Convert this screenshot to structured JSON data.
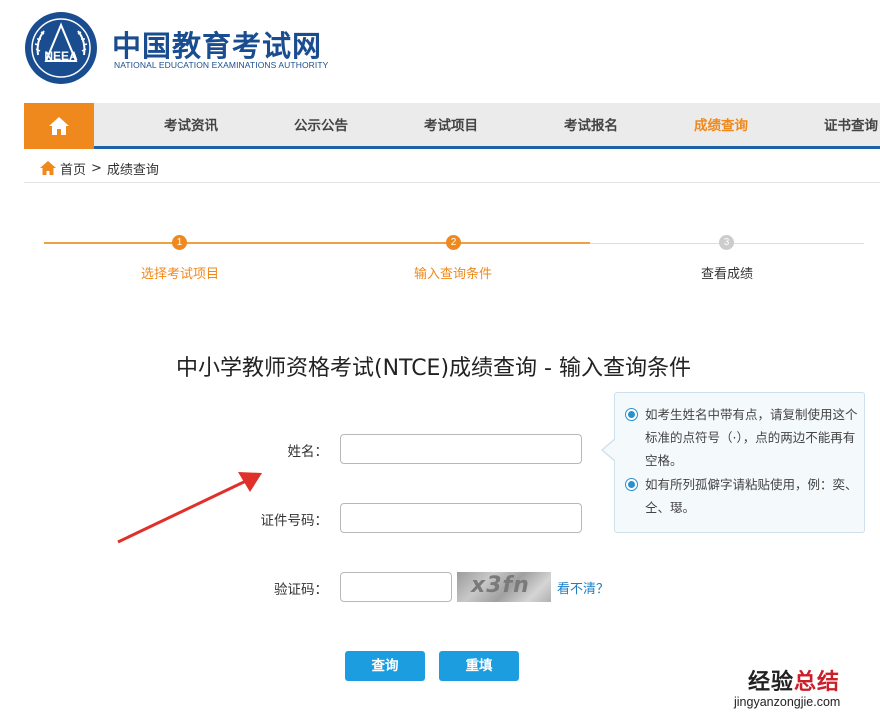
{
  "header": {
    "logo_cn": "中国教育考试网",
    "logo_en": "NATIONAL EDUCATION EXAMINATIONS AUTHORITY",
    "seal_text": "NEEA",
    "brand_color": "#1a4d8f"
  },
  "nav": {
    "home_icon": "home-icon",
    "items": [
      {
        "label": "考试资讯",
        "active": false
      },
      {
        "label": "公示公告",
        "active": false
      },
      {
        "label": "考试项目",
        "active": false
      },
      {
        "label": "考试报名",
        "active": false
      },
      {
        "label": "成绩查询",
        "active": true
      },
      {
        "label": "证书查询",
        "active": false
      }
    ],
    "accent_color": "#f0891d",
    "bar_color": "#1b61a6"
  },
  "breadcrumb": {
    "home": "首页",
    "separator": ">",
    "current": "成绩查询"
  },
  "steps": [
    {
      "num": "1",
      "label": "选择考试项目",
      "state": "done"
    },
    {
      "num": "2",
      "label": "输入查询条件",
      "state": "current"
    },
    {
      "num": "3",
      "label": "查看成绩",
      "state": "pending"
    }
  ],
  "title": "中小学教师资格考试(NTCE)成绩查询 - 输入查询条件",
  "form": {
    "name_label": "姓名：",
    "name_value": "",
    "id_label": "证件号码：",
    "id_value": "",
    "captcha_label": "验证码：",
    "captcha_value": "",
    "captcha_image_text": "x3fn",
    "refresh_link": "看不清？"
  },
  "tips": [
    "如考生姓名中带有点，请复制使用这个标准的点符号（·），点的两边不能再有空格。",
    "如有所列孤僻字请粘贴使用，例：奕、仝、璱。"
  ],
  "buttons": {
    "submit": "查询",
    "reset": "重填"
  },
  "watermark": {
    "black": "经验",
    "red": "总结",
    "url": "jingyanzongjie.com"
  }
}
